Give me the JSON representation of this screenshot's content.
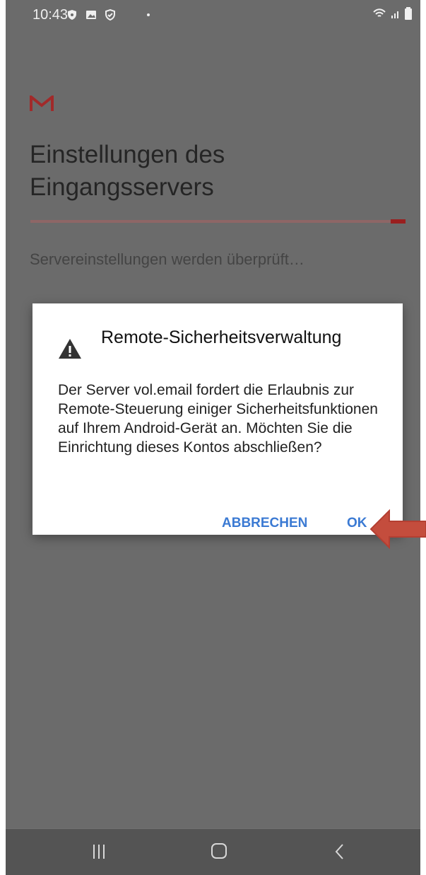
{
  "status": {
    "time": "10:43",
    "icons": [
      "shield-icon",
      "image-icon",
      "security-icon",
      "notification-dot-icon"
    ],
    "right_icons": [
      "wifi-icon",
      "signal-icon",
      "battery-icon"
    ]
  },
  "app": {
    "logo": "M",
    "title": "Einstellungen des Eingangsservers",
    "status_text": "Servereinstellungen werden überprüft…"
  },
  "dialog": {
    "title": "Remote-Sicherheitsverwaltung",
    "body": "Der Server vol.email fordert die Erlaubnis zur Remote-Steuerung einiger Sicherheitsfunktionen auf Ihrem Android-Gerät an. Möchten Sie die Einrichtung dieses Kontos abschließen?",
    "cancel_label": "ABBRECHEN",
    "ok_label": "OK"
  },
  "colors": {
    "overlay_background": "#6b6b6b",
    "dialog_background": "#ffffff",
    "button_text": "#3b7ad3",
    "accent": "#9a1f1f"
  }
}
